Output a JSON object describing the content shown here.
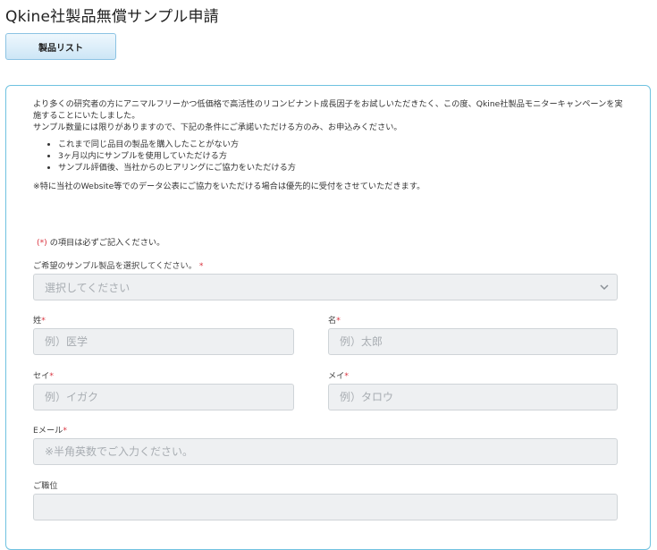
{
  "page": {
    "title": "Qkine社製品無償サンプル申請"
  },
  "toolbar": {
    "product_list_label": "製品リスト"
  },
  "intro": {
    "paragraph1": "より多くの研究者の方にアニマルフリーかつ低価格で高活性のリコンビナント成長因子をお試しいただきたく、この度、Qkine社製品モニターキャンペーンを実施することにいたしました。",
    "paragraph2": "サンプル数量には限りがありますので、下記の条件にご承諾いただける方のみ、お申込みください。",
    "conditions": [
      "これまで同じ品目の製品を購入したことがない方",
      "3ヶ月以内にサンプルを使用していただける方",
      "サンプル評価後、当社からのヒアリングにご協力をいただける方"
    ],
    "note": "※特に当社のWebsite等でのデータ公表にご協力をいただける場合は優先的に受付をさせていただきます。"
  },
  "form": {
    "required_mark": "(*)",
    "required_note": "の項目は必ずご記入ください。",
    "asterisk": "*",
    "product": {
      "label": "ご希望のサンプル製品を選択してください。",
      "selected": "選択してください"
    },
    "last_name": {
      "label": "姓",
      "placeholder": "例）医学"
    },
    "first_name": {
      "label": "名",
      "placeholder": "例）太郎"
    },
    "last_name_kana": {
      "label": "セイ",
      "placeholder": "例）イガク"
    },
    "first_name_kana": {
      "label": "メイ",
      "placeholder": "例）タロウ"
    },
    "email": {
      "label": "Eメール",
      "placeholder": "※半角英数でご入力ください。"
    },
    "job_title": {
      "label": "ご職位",
      "placeholder": ""
    }
  }
}
